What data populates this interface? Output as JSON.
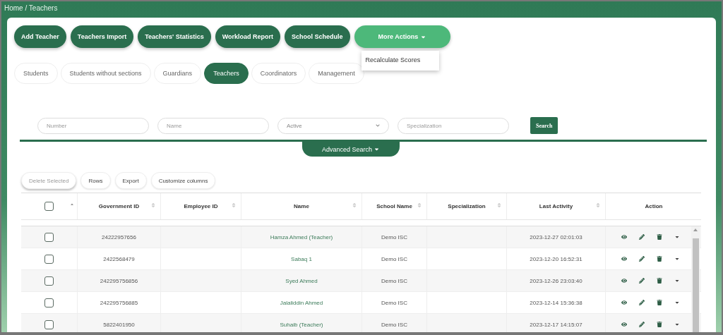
{
  "breadcrumb": "Home / Teachers",
  "actions": [
    {
      "label": "Add Teacher",
      "kind": "primary"
    },
    {
      "label": "Teachers Import",
      "kind": "primary"
    },
    {
      "label": "Teachers' Statistics",
      "kind": "primary"
    },
    {
      "label": "Workload Report",
      "kind": "primary"
    },
    {
      "label": "School Schedule",
      "kind": "primary"
    },
    {
      "label": "More Actions",
      "kind": "menu",
      "expanded": true,
      "menu": [
        "Recalculate Scores"
      ]
    }
  ],
  "tabs": [
    {
      "label": "Students",
      "selected": false
    },
    {
      "label": "Students without sections",
      "selected": false
    },
    {
      "label": "Guardians",
      "selected": false
    },
    {
      "label": "Teachers",
      "selected": true
    },
    {
      "label": "Coordinators",
      "selected": false
    },
    {
      "label": "Management",
      "selected": false
    }
  ],
  "filters": [
    {
      "kind": "text",
      "placeholder": "Number"
    },
    {
      "kind": "text",
      "placeholder": "Name"
    },
    {
      "kind": "select",
      "value": "Active"
    },
    {
      "kind": "text",
      "placeholder": "Specialization"
    }
  ],
  "search_button": "Search",
  "advanced_search": "Advanced Search",
  "table_tools": [
    {
      "label": "Delete Selected",
      "disabled": true
    },
    {
      "label": "Rows",
      "disabled": false
    },
    {
      "label": "Export",
      "disabled": false
    },
    {
      "label": "Customize columns",
      "disabled": false
    }
  ],
  "table": {
    "select_all_checked": false,
    "columns": [
      "Government ID",
      "Employee ID",
      "Name",
      "School Name",
      "Specialization",
      "Last Activity",
      "Action"
    ],
    "rows": [
      {
        "checked": false,
        "government_id": "24222957656",
        "name": "Hamza Ahmed (Teacher)",
        "school": "Demo ISC",
        "last_activity": "2023-12-27 02:01:03"
      },
      {
        "checked": false,
        "government_id": "2422568479",
        "name": "Sabaq 1",
        "school": "Demo ISC",
        "last_activity": "2023-12-20 16:52:31"
      },
      {
        "checked": false,
        "government_id": "242295756856",
        "name": "Syed Ahmed",
        "school": "Demo ISC",
        "last_activity": "2023-12-26 23:03:40"
      },
      {
        "checked": false,
        "government_id": "242295756885",
        "name": "Jalaliddin Ahmed",
        "school": "Demo ISC",
        "last_activity": "2023-12-14 15:36:38"
      },
      {
        "checked": false,
        "government_id": "5822401950",
        "name": "Suhaib (Teacher)",
        "school": "Demo ISC",
        "last_activity": "2023-12-17 14:15:07"
      }
    ]
  }
}
